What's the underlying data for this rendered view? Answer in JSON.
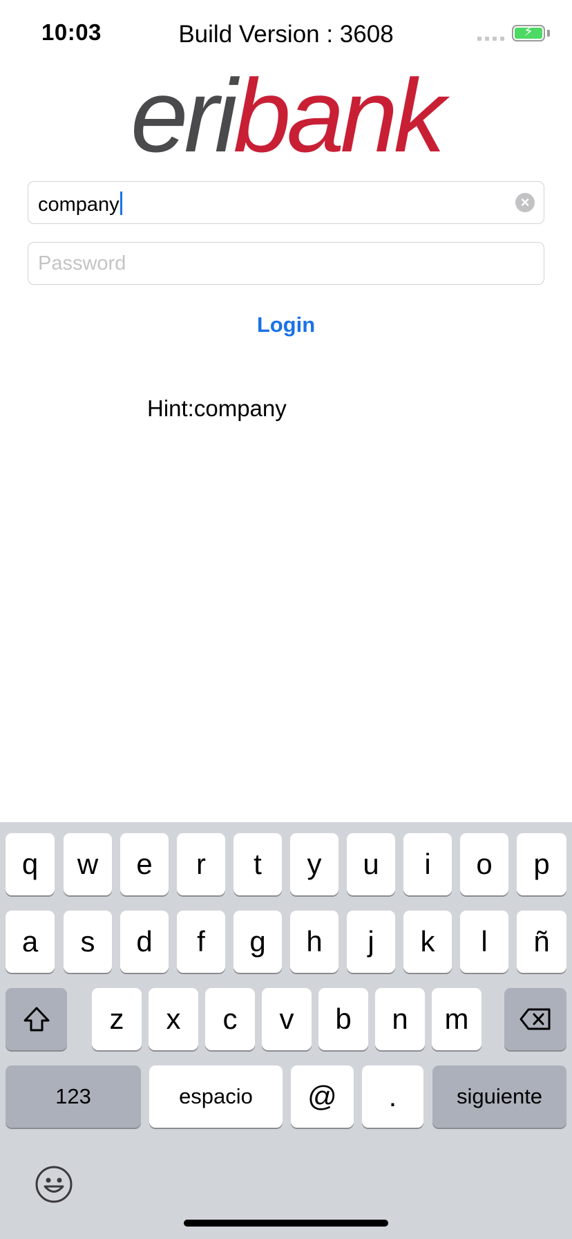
{
  "status_bar": {
    "time": "10:03",
    "build_version": "Build Version : 3608",
    "battery_color": "#4cd964"
  },
  "logo": {
    "part1": "eri",
    "part2": "bank",
    "part1_color": "#4a4a4c",
    "part2_color": "#c81f35"
  },
  "form": {
    "username_value": "company",
    "password_placeholder": "Password",
    "login_label": "Login",
    "hint": "Hint:company",
    "accent_color": "#1a73e8"
  },
  "keyboard": {
    "row1": [
      "q",
      "w",
      "e",
      "r",
      "t",
      "y",
      "u",
      "i",
      "o",
      "p"
    ],
    "row2": [
      "a",
      "s",
      "d",
      "f",
      "g",
      "h",
      "j",
      "k",
      "l",
      "ñ"
    ],
    "row3": [
      "z",
      "x",
      "c",
      "v",
      "b",
      "n",
      "m"
    ],
    "numbers_label": "123",
    "space_label": "espacio",
    "at_label": "@",
    "period_label": ".",
    "next_label": "siguiente",
    "shift_icon": "shift-icon",
    "delete_icon": "delete-icon",
    "emoji_icon": "emoji-icon"
  }
}
